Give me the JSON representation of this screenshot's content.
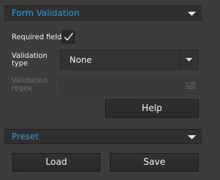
{
  "form_validation": {
    "title": "Form Validation",
    "required_field": {
      "label": "Required field",
      "checked": true
    },
    "validation_type": {
      "label_line1": "Validation",
      "label_line2": "type",
      "selected": "None"
    },
    "validation_regex": {
      "label_line1": "Validation",
      "label_line2": "regex",
      "value": "",
      "enabled": false,
      "button_icon": "text-list-icon"
    },
    "help_label": "Help"
  },
  "preset": {
    "title": "Preset",
    "load_label": "Load",
    "save_label": "Save"
  },
  "colors": {
    "accent": "#2f9de4",
    "panel_bg": "#3c3c3c",
    "header_bg": "#2f2f2f",
    "disabled_text": "#6f6f6f"
  }
}
